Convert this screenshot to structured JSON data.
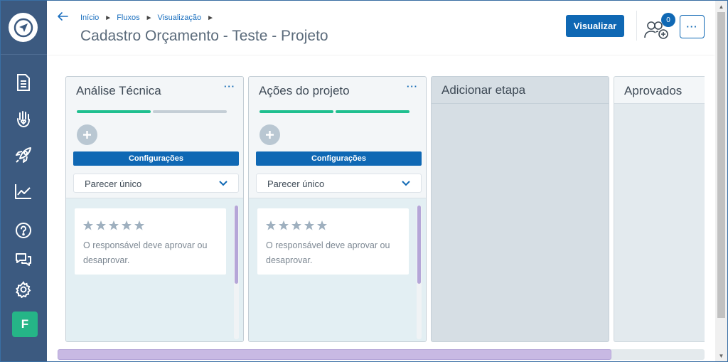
{
  "colors": {
    "sidebar_bg": "#3c5a80",
    "primary": "#0f68b4",
    "progress_done": "#1fbf8f",
    "progress_todo": "#c4ced6",
    "avatar_bg": "#25b587",
    "scroll_thumb": "#c8b9e3"
  },
  "sidebar": {
    "logo_icon": "paper-plane-logo",
    "items": [
      {
        "icon": "document-icon"
      },
      {
        "icon": "hand-heart-icon"
      },
      {
        "icon": "rocket-icon"
      },
      {
        "icon": "chart-line-icon"
      },
      {
        "icon": "help-circle-icon"
      },
      {
        "icon": "chat-bubbles-icon"
      },
      {
        "icon": "gear-icon"
      }
    ],
    "avatar_letter": "F"
  },
  "header": {
    "breadcrumbs": [
      "Início",
      "Fluxos",
      "Visualização"
    ],
    "title": "Cadastro Orçamento - Teste - Projeto",
    "visualizar_label": "Visualizar",
    "participants_count": "0",
    "more_label": "···"
  },
  "columns": [
    {
      "title": "Análise Técnica",
      "more_label": "···",
      "progress": [
        1,
        0
      ],
      "config_label": "Configurações",
      "select_value": "Parecer único",
      "card": {
        "stars": 5,
        "text": "O responsável deve aprovar ou desaprovar."
      }
    },
    {
      "title": "Ações do projeto",
      "more_label": "···",
      "progress": [
        1,
        1
      ],
      "config_label": "Configurações",
      "select_value": "Parecer único",
      "card": {
        "stars": 5,
        "text": "O responsável deve aprovar ou desaprovar."
      }
    },
    {
      "title": "Adicionar etapa"
    },
    {
      "title": "Aprovados"
    }
  ]
}
